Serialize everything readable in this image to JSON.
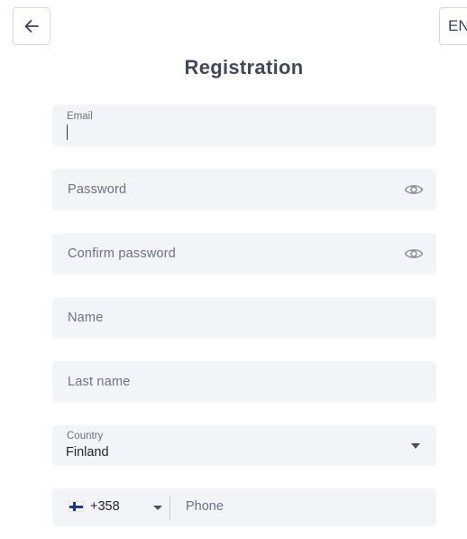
{
  "header": {
    "back_icon": "arrow-left-icon",
    "language": "EN",
    "title": "Registration"
  },
  "form": {
    "email": {
      "label": "Email",
      "value": ""
    },
    "password": {
      "placeholder": "Password",
      "icon": "eye-icon"
    },
    "confirm_password": {
      "placeholder": "Confirm password",
      "icon": "eye-icon"
    },
    "name": {
      "placeholder": "Name"
    },
    "last_name": {
      "placeholder": "Last name"
    },
    "country": {
      "label": "Country",
      "value": "Finland"
    },
    "phone": {
      "flag_icon": "finland-flag-icon",
      "dial_code": "+358",
      "placeholder": "Phone"
    }
  },
  "colors": {
    "field_background": "#f3f4f7",
    "title": "#424856",
    "placeholder": "#6b7280"
  }
}
